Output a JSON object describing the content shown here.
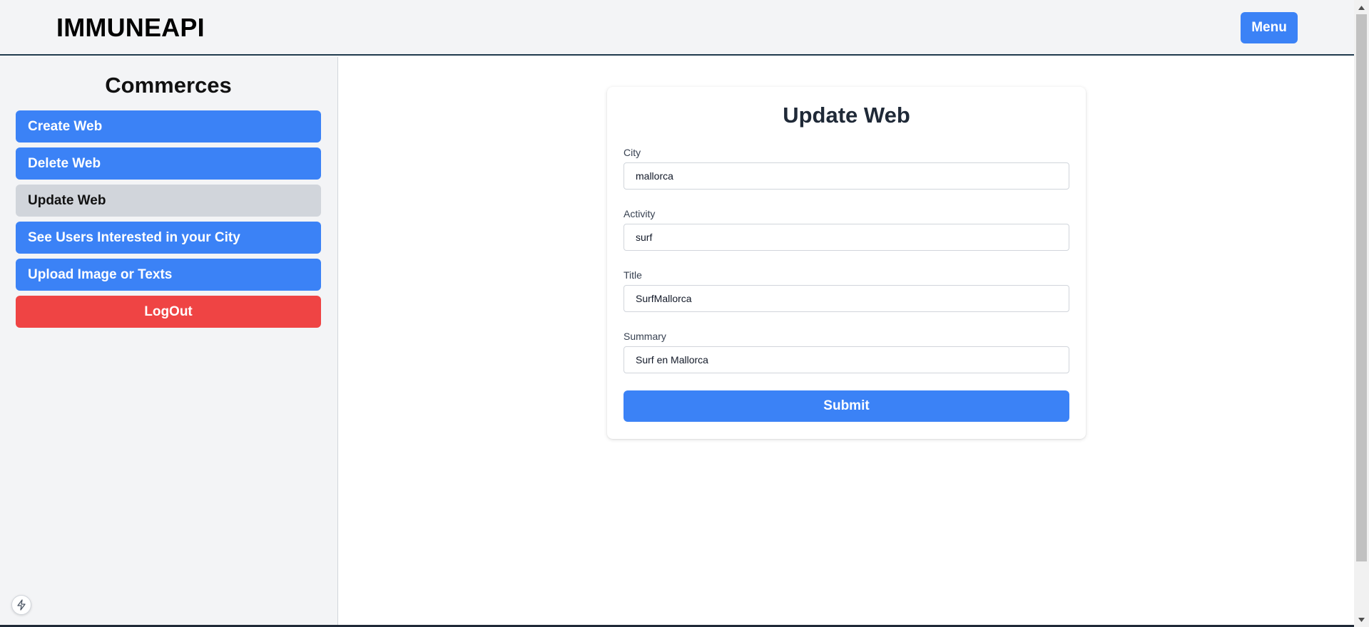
{
  "header": {
    "brand": "IMMUNEAPI",
    "menu_label": "Menu"
  },
  "sidebar": {
    "title": "Commerces",
    "items": [
      {
        "label": "Create Web",
        "active": false
      },
      {
        "label": "Delete Web",
        "active": false
      },
      {
        "label": "Update Web",
        "active": true
      },
      {
        "label": "See Users Interested in your City",
        "active": false
      },
      {
        "label": "Upload Image or Texts",
        "active": false
      }
    ],
    "logout_label": "LogOut"
  },
  "form": {
    "title": "Update Web",
    "fields": [
      {
        "label": "City",
        "value": "mallorca"
      },
      {
        "label": "Activity",
        "value": "surf"
      },
      {
        "label": "Title",
        "value": "SurfMallorca"
      },
      {
        "label": "Summary",
        "value": "Surf en Mallorca"
      }
    ],
    "submit_label": "Submit"
  },
  "icons": {
    "bolt": "lightning-bolt-icon",
    "scroll_up": "scroll-up-arrow-icon",
    "scroll_down": "scroll-down-arrow-icon"
  },
  "colors": {
    "primary": "#3b82f6",
    "danger": "#ef4444",
    "active": "#d1d5db",
    "background": "#f3f4f6"
  }
}
